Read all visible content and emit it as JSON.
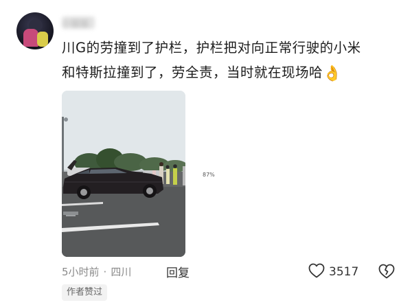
{
  "user": {
    "avatar": "avatar-icon",
    "name": "小猫猫"
  },
  "comment": {
    "text_line1": "川G的劳撞到了护栏，护栏把对向正常行驶的小米",
    "text_line2": "和特斯拉撞到了，劳全责，当时就在现场哈",
    "emoji": "👌"
  },
  "photo": {
    "progress_label": "87%"
  },
  "meta": {
    "time": "5小时前",
    "separator": "·",
    "location": "四川",
    "reply_label": "回复"
  },
  "actions": {
    "like_icon": "heart-outline-icon",
    "like_count": "3517",
    "dislike_icon": "broken-heart-icon"
  },
  "badge": {
    "label": "作者赞过"
  }
}
